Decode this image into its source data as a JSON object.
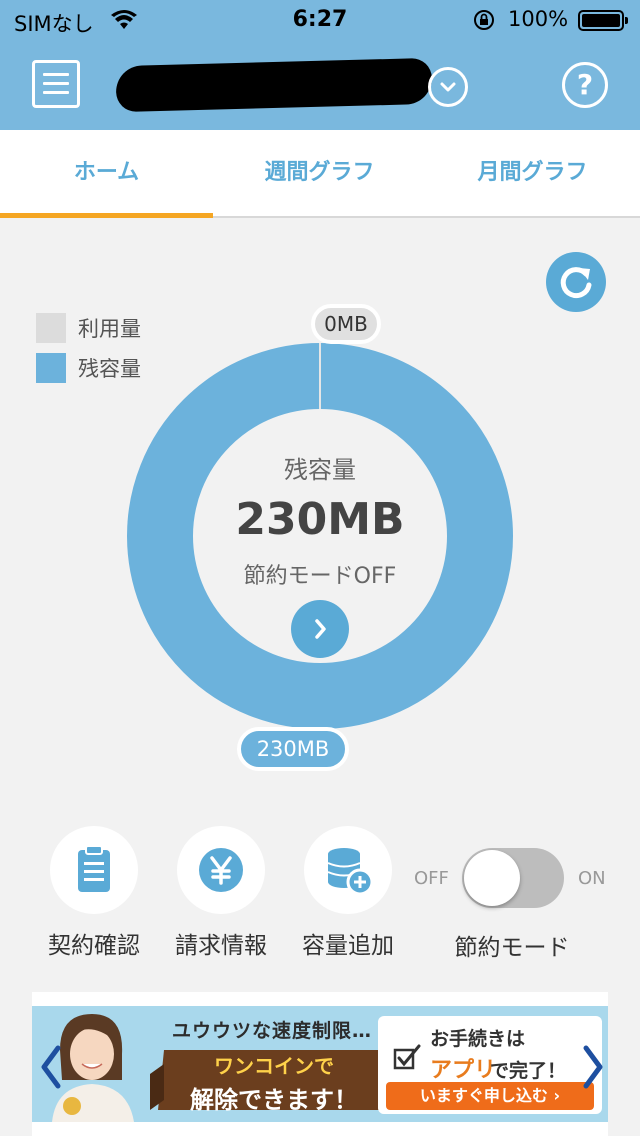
{
  "status_bar": {
    "carrier": "SIMなし",
    "time": "6:27",
    "battery": "100%"
  },
  "header": {
    "menu_icon": "hamburger-menu-icon",
    "dropdown_icon": "chevron-down-icon",
    "help_icon": "question-icon",
    "help_label": "?"
  },
  "tabs": [
    {
      "label": "ホーム",
      "active": true
    },
    {
      "label": "週間グラフ",
      "active": false
    },
    {
      "label": "月間グラフ",
      "active": false
    }
  ],
  "legend": [
    {
      "label": "利用量",
      "color": "#dcdcdc"
    },
    {
      "label": "残容量",
      "color": "#6cb2dc"
    }
  ],
  "usage": {
    "used_label": "0MB",
    "remaining_label": "230MB",
    "used_mb": 0,
    "remaining_mb": 230,
    "center_title": "残容量",
    "center_value": "230MB",
    "saving_mode_status": "節約モードOFF"
  },
  "actions": [
    {
      "label": "契約確認",
      "icon": "clipboard-icon"
    },
    {
      "label": "請求情報",
      "icon": "yen-icon"
    },
    {
      "label": "容量追加",
      "icon": "database-add-icon"
    }
  ],
  "saving_toggle": {
    "off_label": "OFF",
    "on_label": "ON",
    "label": "節約モード",
    "is_on": false
  },
  "banner": {
    "headline": "ユウウツな速度制限…",
    "ribbon_line1": "ワンコインで",
    "ribbon_line2": "解除できます！",
    "procedure": "お手続きは",
    "app_word": "アプリ",
    "done": "で完了！",
    "cta": "いますぐ申し込む ›"
  },
  "colors": {
    "accent": "#7ab8de",
    "primary_blue": "#5aaad6",
    "tab_indicator": "#f5a623"
  }
}
